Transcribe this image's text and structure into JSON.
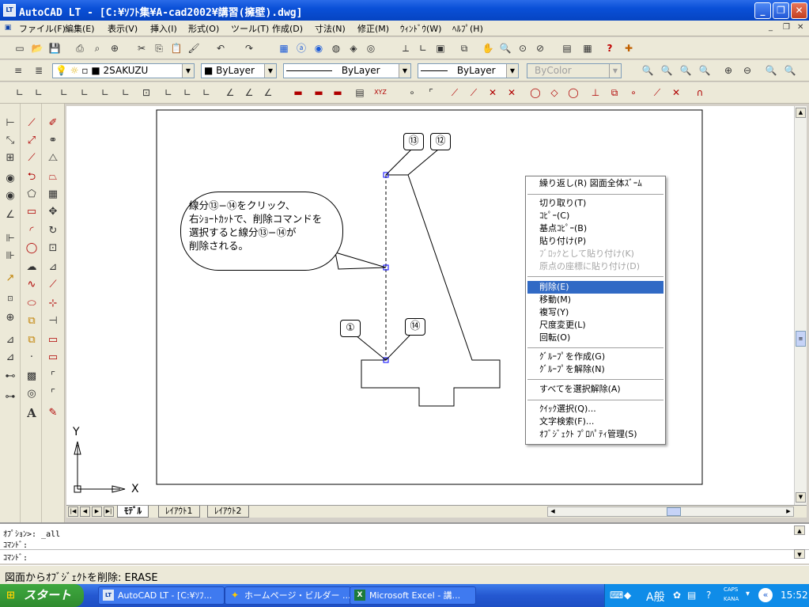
{
  "window": {
    "title": "AutoCAD LT - [C:¥ｿﾌﾄ集¥A-cad2002¥講習(擁壁).dwg]",
    "app_icon": "LT"
  },
  "menubar": {
    "items": [
      "ファイル(F)",
      "編集(E)",
      "表示(V)",
      "挿入(I)",
      "形式(O)",
      "ツール(T)",
      "作成(D)",
      "寸法(N)",
      "修正(M)",
      "ｳｨﾝﾄﾞｳ(W)",
      "ﾍﾙﾌﾟ(H)"
    ]
  },
  "props": {
    "layer": "2SAKUZU",
    "color": "ByLayer",
    "linetype": "ByLayer",
    "lineweight": "ByLayer",
    "plotstyle": "ByColor"
  },
  "labels": {
    "p13": "⑬",
    "p12": "⑫",
    "p1": "①",
    "p14": "⑭"
  },
  "callout": {
    "line1": "線分⑬−⑭をクリック、",
    "line2": "右ｼｮｰﾄｶｯﾄで、削除コマンドを",
    "line3": "選択すると線分⑬−⑭が",
    "line4": "削除される。"
  },
  "context_menu": {
    "items": [
      {
        "label": "繰り返し(R) 図面全体ｽﾞｰﾑ",
        "enabled": true
      },
      {
        "label": "切り取り(T)",
        "enabled": true
      },
      {
        "label": "ｺﾋﾟｰ(C)",
        "enabled": true
      },
      {
        "label": "基点ｺﾋﾟｰ(B)",
        "enabled": true
      },
      {
        "label": "貼り付け(P)",
        "enabled": true
      },
      {
        "label": "ﾌﾞﾛｯｸとして貼り付け(K)",
        "enabled": false
      },
      {
        "label": "原点の座標に貼り付け(D)",
        "enabled": false
      },
      {
        "label": "削除(E)",
        "enabled": true,
        "selected": true
      },
      {
        "label": "移動(M)",
        "enabled": true
      },
      {
        "label": "複写(Y)",
        "enabled": true
      },
      {
        "label": "尺度変更(L)",
        "enabled": true
      },
      {
        "label": "回転(O)",
        "enabled": true
      },
      {
        "label": "ｸﾞﾙｰﾌﾟを作成(G)",
        "enabled": true
      },
      {
        "label": "ｸﾞﾙｰﾌﾟを解除(N)",
        "enabled": true
      },
      {
        "label": "すべてを選択解除(A)",
        "enabled": true
      },
      {
        "label": "ｸｲｯｸ選択(Q)...",
        "enabled": true
      },
      {
        "label": "文字検索(F)...",
        "enabled": true
      },
      {
        "label": "ｵﾌﾞｼﾞｪｸﾄ ﾌﾟﾛﾊﾟﾃｨ管理(S)",
        "enabled": true
      }
    ]
  },
  "ucs": {
    "x": "X",
    "y": "Y"
  },
  "tabs": {
    "model": "ﾓﾃﾞﾙ",
    "layout1": "ﾚｲｱｳﾄ1",
    "layout2": "ﾚｲｱｳﾄ2"
  },
  "command": {
    "line1": "ｵﾌﾟｼｮﾝ>: _all",
    "line2": "ｺﾏﾝﾄﾞ:",
    "line3": "ｺﾏﾝﾄﾞ:"
  },
  "status": {
    "text": "図面からｵﾌﾞｼﾞｪｸﾄを削除:  ERASE"
  },
  "taskbar": {
    "start": "スタート",
    "tasks": [
      "AutoCAD LT - [C:¥ｿﾌ...",
      "ホームページ・ビルダー ...",
      "Microsoft Excel - 講..."
    ],
    "ime": "A般",
    "caps": "CAPS",
    "kana": "KANA",
    "clock": "15:52"
  },
  "colors": {
    "accent": "#316ac5",
    "titlebar": "#0a50d8",
    "taskbar": "#2458d1"
  }
}
